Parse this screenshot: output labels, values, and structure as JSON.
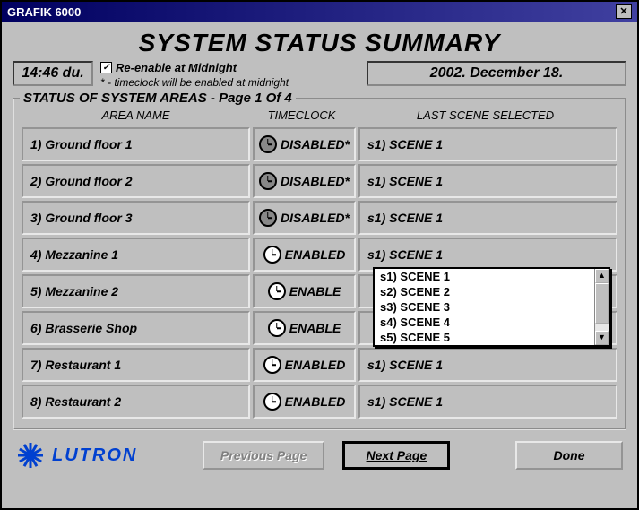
{
  "window": {
    "title": "GRAFIK 6000"
  },
  "header": {
    "main_title": "SYSTEM STATUS SUMMARY",
    "time": "14:46 du.",
    "reenable_label": "Re-enable at Midnight",
    "reenable_note": "* - timeclock will be enabled at midnight",
    "date": "2002. December 18."
  },
  "section": {
    "legend": "STATUS OF SYSTEM AREAS - Page 1 Of 4",
    "columns": {
      "area": "AREA NAME",
      "timeclock": "TIMECLOCK",
      "scene": "LAST SCENE SELECTED"
    }
  },
  "rows": [
    {
      "area": "1) Ground floor 1",
      "timeclock": "DISABLED*",
      "enabled": false,
      "scene": "s1) SCENE 1"
    },
    {
      "area": "2) Ground floor 2",
      "timeclock": "DISABLED*",
      "enabled": false,
      "scene": "s1) SCENE 1"
    },
    {
      "area": "3) Ground floor 3",
      "timeclock": "DISABLED*",
      "enabled": false,
      "scene": "s1) SCENE 1"
    },
    {
      "area": "4) Mezzanine 1",
      "timeclock": "ENABLED",
      "enabled": true,
      "scene": "s1) SCENE 1"
    },
    {
      "area": "5) Mezzanine 2",
      "timeclock": "ENABLE",
      "enabled": true,
      "scene": ""
    },
    {
      "area": "6) Brasserie Shop",
      "timeclock": "ENABLE",
      "enabled": true,
      "scene": ""
    },
    {
      "area": "7) Restaurant 1",
      "timeclock": "ENABLED",
      "enabled": true,
      "scene": "s1) SCENE 1"
    },
    {
      "area": "8) Restaurant 2",
      "timeclock": "ENABLED",
      "enabled": true,
      "scene": "s1) SCENE 1"
    }
  ],
  "dropdown": {
    "options": [
      "s1) SCENE 1",
      "s2) SCENE 2",
      "s3) SCENE 3",
      "s4) SCENE 4",
      "s5) SCENE 5"
    ]
  },
  "footer": {
    "brand": "LUTRON",
    "prev": "Previous Page",
    "next": "Next Page",
    "done": "Done"
  }
}
